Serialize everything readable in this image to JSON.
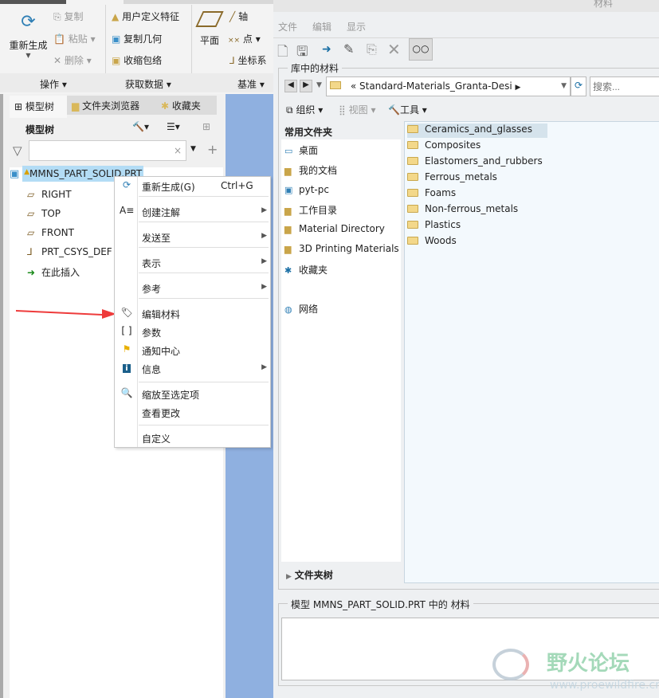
{
  "ribbon": {
    "regenerate": "重新生成",
    "copy": "复制",
    "paste": "粘贴",
    "delete": "删除",
    "user_feature": "用户定义特征",
    "copy_geometry": "复制几何",
    "shrinkwrap": "收缩包络",
    "plane": "平面",
    "axis": "轴",
    "point": "点",
    "csys": "坐标系",
    "groups": [
      "操作",
      "获取数据",
      "基准"
    ]
  },
  "panel": {
    "tabs": [
      "模型树",
      "文件夹浏览器",
      "收藏夹"
    ],
    "header": "模型树",
    "filter_value": "",
    "tree": {
      "root": "MMNS_PART_SOLID.PRT",
      "items": [
        "RIGHT",
        "TOP",
        "FRONT",
        "PRT_CSYS_DEF",
        "在此插入"
      ]
    }
  },
  "context_menu": {
    "regenerate": "重新生成(G)",
    "regenerate_shortcut": "Ctrl+G",
    "create_annotation": "创建注解",
    "send_to": "发送至",
    "represent": "表示",
    "reference": "参考",
    "edit_material": "编辑材料",
    "parameters": "参数",
    "notification_center": "通知中心",
    "info": "信息",
    "zoom_to_selected": "缩放至选定项",
    "view_changes": "查看更改",
    "customize": "自定义"
  },
  "dialog": {
    "title": "材料",
    "menu": [
      "文件",
      "编辑",
      "显示"
    ],
    "library_group": "库中的材料",
    "path": "Standard-Materials_Granta-Desi",
    "search_placeholder": "搜索...",
    "organize": "组织",
    "view": "视图",
    "tools": "工具",
    "favorites_header": "常用文件夹",
    "favorites": [
      "桌面",
      "我的文档",
      "pyt-pc",
      "工作目录",
      "Material Directory",
      "3D Printing Materials",
      "收藏夹",
      "网络"
    ],
    "folders": [
      "Ceramics_and_glasses",
      "Composites",
      "Elastomers_and_rubbers",
      "Ferrous_metals",
      "Foams",
      "Non-ferrous_metals",
      "Plastics",
      "Woods"
    ],
    "folder_tree": "文件夹树",
    "model_group": "模型 MMNS_PART_SOLID.PRT 中的 材料"
  },
  "watermark": {
    "name": "野火论坛",
    "url": "www.proewildfire.cn"
  },
  "colors": {
    "selection": "#b3dcf5",
    "blue_bg": "#8fb0e0",
    "arrow": "#ee3b3b",
    "folder_pane": "#f3f9fd"
  }
}
